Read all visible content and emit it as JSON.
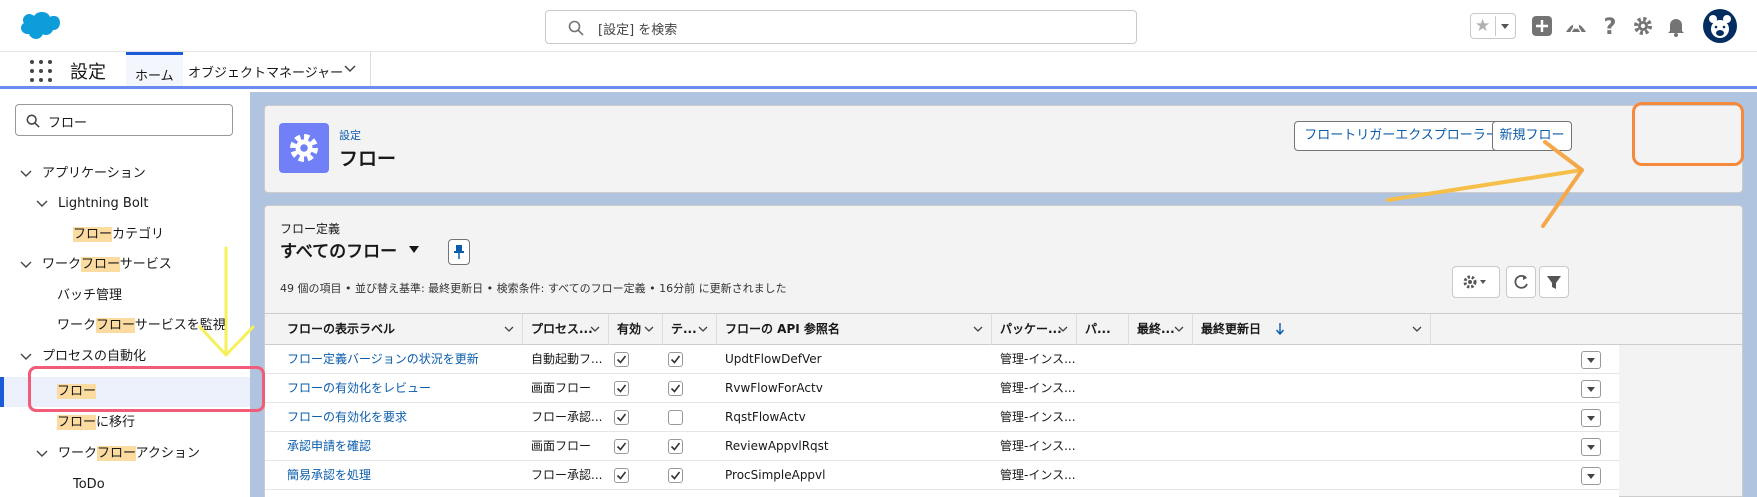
{
  "header": {
    "search_placeholder": "[設定] を検索",
    "icons": [
      "favorites-star-icon",
      "add-icon",
      "trailhead-icon",
      "help-icon",
      "setup-gear-icon",
      "notification-bell-icon",
      "avatar"
    ]
  },
  "nav": {
    "app_name": "設定",
    "tabs": [
      {
        "label": "ホーム",
        "active": true
      },
      {
        "label": "オブジェクトマネージャー",
        "active": false
      }
    ]
  },
  "sidebar": {
    "quick_find_value": "フロー",
    "items": [
      {
        "pre": "アプリケーション",
        "hl": "",
        "post": "",
        "level": 0,
        "expanded": true
      },
      {
        "pre": "Lightning Bolt",
        "hl": "",
        "post": "",
        "level": 1,
        "expanded": true
      },
      {
        "pre": "",
        "hl": "フロー",
        "post": "カテゴリ",
        "level": 2
      },
      {
        "pre": "ワーク",
        "hl": "フロー",
        "post": "サービス",
        "level": 0,
        "expanded": true
      },
      {
        "pre": "バッチ管理",
        "hl": "",
        "post": "",
        "level": 1
      },
      {
        "pre": "ワーク",
        "hl": "フロー",
        "post": "サービスを監視",
        "level": 1
      },
      {
        "pre": "プロセスの自動化",
        "hl": "",
        "post": "",
        "level": 0,
        "expanded": true
      },
      {
        "pre": "",
        "hl": "フロー",
        "post": "",
        "level": 1,
        "selected": true
      },
      {
        "pre": "",
        "hl": "フロー",
        "post": "に移行",
        "level": 1
      },
      {
        "pre": "ワーク",
        "hl": "フロー",
        "post": "アクション",
        "level": 1,
        "expanded": true
      },
      {
        "pre": "ToDo",
        "hl": "",
        "post": "",
        "level": 2
      }
    ]
  },
  "page_header": {
    "breadcrumb": "設定",
    "title": "フロー",
    "buttons": {
      "trigger_explorer": "フロートリガーエクスプローラー",
      "new_flow": "新規フロー"
    }
  },
  "list_view": {
    "object_label": "フロー定義",
    "view_name": "すべてのフロー",
    "meta": "49 個の項目 • 並び替え基準: 最終更新日 • 検索条件: すべてのフロー定義 • 16分前 に更新されました",
    "columns": [
      "フローの表示ラベル",
      "プロセス...",
      "有効",
      "テ...",
      "フローの API 参照名",
      "パッケー...",
      "パ...",
      "最終...",
      "最終更新日"
    ],
    "rows": [
      {
        "label": "フロー定義バージョンの状況を更新",
        "process": "自動起動フ...",
        "active": true,
        "template": true,
        "api": "UpdtFlowDefVer",
        "package": "管理-インス..."
      },
      {
        "label": "フローの有効化をレビュー",
        "process": "画面フロー",
        "active": true,
        "template": true,
        "api": "RvwFlowForActv",
        "package": "管理-インス..."
      },
      {
        "label": "フローの有効化を要求",
        "process": "フロー承認...",
        "active": true,
        "template": false,
        "api": "RqstFlowActv",
        "package": "管理-インス..."
      },
      {
        "label": "承認申請を確認",
        "process": "画面フロー",
        "active": true,
        "template": true,
        "api": "ReviewAppvlRqst",
        "package": "管理-インス..."
      },
      {
        "label": "簡易承認を処理",
        "process": "フロー承認...",
        "active": true,
        "template": true,
        "api": "ProcSimpleAppvl",
        "package": "管理-インス..."
      }
    ]
  },
  "colors": {
    "brand_blue": "#1b5bd8",
    "link_blue": "#0b5cab",
    "highlight": "#fcdba1",
    "annotation_orange": "#f5893d",
    "annotation_pink": "#f25c78",
    "annotation_yellow": "#f5f05a"
  }
}
